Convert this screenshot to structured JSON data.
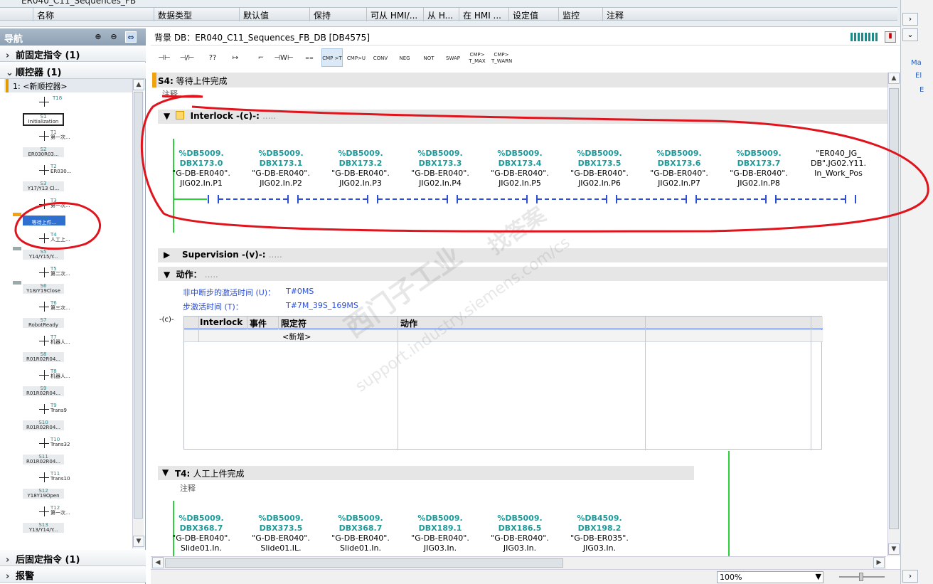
{
  "table_header": {
    "tab_title": "ER040_C11_Sequences_FB",
    "columns": [
      "名称",
      "数据类型",
      "默认值",
      "保持",
      "可从 HMI/...",
      "从 H...",
      "在 HMI ...",
      "设定值",
      "监控",
      "注释"
    ]
  },
  "navigation": {
    "title": "导航",
    "sections": [
      {
        "arrow": "›",
        "label": "前固定指令 (1)"
      },
      {
        "arrow": "⌄",
        "label": "顺控器 (1)"
      }
    ],
    "sequencer_label": "1: <新顺控器>",
    "bottom_sections": [
      {
        "arrow": "›",
        "label": "后固定指令 (1)"
      },
      {
        "arrow": "›",
        "label": "报警"
      }
    ],
    "tree": [
      {
        "kind": "trans",
        "id": "T18",
        "text": ""
      },
      {
        "kind": "step",
        "id": "S1",
        "text": "Initialization"
      },
      {
        "kind": "trans",
        "id": "T1",
        "text": "第一次..."
      },
      {
        "kind": "step",
        "id": "S2",
        "text": "ER030R03..."
      },
      {
        "kind": "trans",
        "id": "T2",
        "text": "ER030..."
      },
      {
        "kind": "step",
        "id": "S3",
        "text": "Y17/Y13 Cl..."
      },
      {
        "kind": "trans",
        "id": "T3",
        "text": "第一次..."
      },
      {
        "kind": "step",
        "id": "S4",
        "text": "等待上件..."
      },
      {
        "kind": "trans",
        "id": "T4",
        "text": "人工上..."
      },
      {
        "kind": "step",
        "id": "S5",
        "text": "Y14/Y15/Y..."
      },
      {
        "kind": "trans",
        "id": "T5",
        "text": "第二次..."
      },
      {
        "kind": "step",
        "id": "S6",
        "text": "Y18/Y19Close"
      },
      {
        "kind": "trans",
        "id": "T6",
        "text": "第三次..."
      },
      {
        "kind": "step",
        "id": "S7",
        "text": "RobotReady"
      },
      {
        "kind": "trans",
        "id": "T7",
        "text": "机器人..."
      },
      {
        "kind": "step",
        "id": "S8",
        "text": "R01R02R04..."
      },
      {
        "kind": "trans",
        "id": "T8",
        "text": "机器人..."
      },
      {
        "kind": "step",
        "id": "S9",
        "text": "R01R02R04..."
      },
      {
        "kind": "trans",
        "id": "T9",
        "text": "Trans9"
      },
      {
        "kind": "step",
        "id": "S10",
        "text": "R01R02R04..."
      },
      {
        "kind": "trans",
        "id": "T10",
        "text": "Trans32"
      },
      {
        "kind": "step",
        "id": "S11",
        "text": "R01R02R04..."
      },
      {
        "kind": "trans",
        "id": "T11",
        "text": "Trans10"
      },
      {
        "kind": "step",
        "id": "S12",
        "text": "Y18Y19Open"
      },
      {
        "kind": "trans",
        "id": "T12",
        "text": "第一次..."
      },
      {
        "kind": "step",
        "id": "S13",
        "text": "Y13/Y14/Y..."
      }
    ]
  },
  "editor": {
    "header": "背景 DB：ER040_C11_Sequences_FB_DB [DB4575]",
    "toolbar": [
      "⊣⊢",
      "⊣/⊢",
      "??",
      "↦",
      "⌐",
      "⊣W⊢",
      "==",
      "CMP >T",
      "CMP>U",
      "CONV",
      "NEG",
      "NOT",
      "SWAP",
      "CMP>\nT_MAX",
      "CMP>\nT_WARN"
    ],
    "step": {
      "id": "S4:",
      "name": "等待上件完成",
      "comment": "注释"
    },
    "interlock": {
      "title": "Interlock -(c)-:",
      "dots": ".....",
      "contacts": [
        {
          "addr": "%DB5009.\nDBX173.0",
          "sym": "\"G-DB-ER040\".\nJIG02.In.P1"
        },
        {
          "addr": "%DB5009.\nDBX173.1",
          "sym": "\"G-DB-ER040\".\nJIG02.In.P2"
        },
        {
          "addr": "%DB5009.\nDBX173.2",
          "sym": "\"G-DB-ER040\".\nJIG02.In.P3"
        },
        {
          "addr": "%DB5009.\nDBX173.3",
          "sym": "\"G-DB-ER040\".\nJIG02.In.P4"
        },
        {
          "addr": "%DB5009.\nDBX173.4",
          "sym": "\"G-DB-ER040\".\nJIG02.In.P5"
        },
        {
          "addr": "%DB5009.\nDBX173.5",
          "sym": "\"G-DB-ER040\".\nJIG02.In.P6"
        },
        {
          "addr": "%DB5009.\nDBX173.6",
          "sym": "\"G-DB-ER040\".\nJIG02.In.P7"
        },
        {
          "addr": "%DB5009.\nDBX173.7",
          "sym": "\"G-DB-ER040\".\nJIG02.In.P8"
        },
        {
          "addr": "",
          "sym": "\"ER040_JG_\nDB\".JG02.Y11.\nIn_Work_Pos"
        }
      ]
    },
    "supervision": {
      "title": "Supervision -(v)-:",
      "dots": "....."
    },
    "actions": {
      "title": "动作：",
      "dots": ".....",
      "nonstop_label": "非中断步的激活时间 (U)：",
      "nonstop_value": "T#0MS",
      "active_label": "步激活时间 (T)：",
      "active_value": "T#7M_39S_169MS",
      "coil": "-(c)-",
      "cols": [
        "Interlock",
        "事件",
        "限定符",
        "动作"
      ],
      "new_row": "<新增>"
    },
    "transition": {
      "id": "T4:",
      "name": "人工上件完成",
      "comment": "注释",
      "contacts": [
        {
          "addr": "%DB5009.\nDBX368.7",
          "sym": "\"G-DB-ER040\".\nSlide01.In."
        },
        {
          "addr": "%DB5009.\nDBX373.5",
          "sym": "\"G-DB-ER040\".\nSlide01.IL."
        },
        {
          "addr": "%DB5009.\nDBX368.7",
          "sym": "\"G-DB-ER040\".\nSlide01.In."
        },
        {
          "addr": "%DB5009.\nDBX189.1",
          "sym": "\"G-DB-ER040\".\nJIG03.In."
        },
        {
          "addr": "%DB5009.\nDBX186.5",
          "sym": "\"G-DB-ER040\".\nJIG03.In."
        },
        {
          "addr": "%DB4509.\nDBX198.2",
          "sym": "\"G-DB-ER035\".\nJIG03.In."
        }
      ]
    },
    "zoom": "100%"
  },
  "rail_text": [
    "Ma",
    "El",
    "E"
  ],
  "watermark": [
    "西门子工业",
    "找答案",
    "support.industry.siemens.com/cs"
  ],
  "colors": {
    "accent": "#f1a30f",
    "address": "#1e9a9a",
    "wire": "#2fcf3b",
    "dashed": "#2b4fd8",
    "annotation": "#e0141c"
  }
}
